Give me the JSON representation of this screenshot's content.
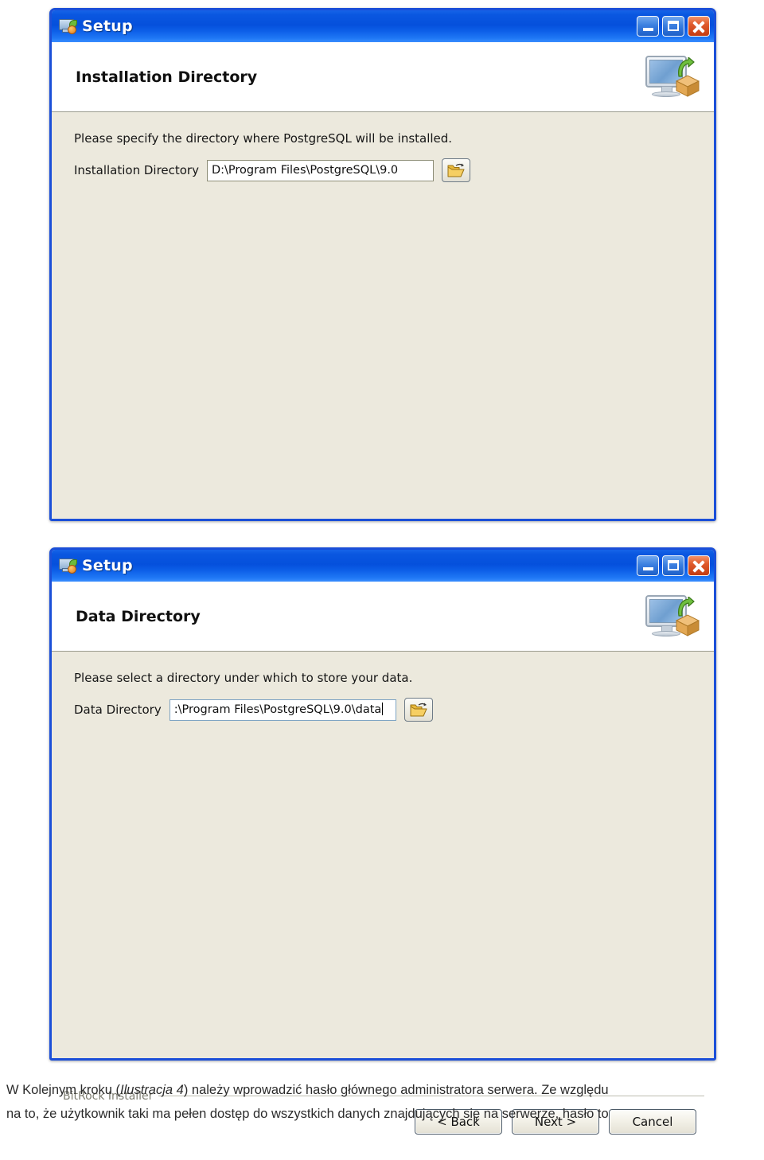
{
  "windows": [
    {
      "id": "installation-directory",
      "title": "Setup",
      "header_title": "Installation Directory",
      "instruction": "Please specify the directory where PostgreSQL will be installed.",
      "field_label": "Installation Directory",
      "field_value": "D:\\Program Files\\PostgreSQL\\9.0",
      "field_focused": false,
      "browse_icon": "open-folder-icon",
      "brand": "BitRock Installer",
      "buttons": {
        "back": "< Back",
        "next": "Next >",
        "cancel": "Cancel"
      },
      "window_controls": {
        "minimize": "minimize-icon",
        "maximize": "maximize-icon",
        "close": "close-icon"
      }
    },
    {
      "id": "data-directory",
      "title": "Setup",
      "header_title": "Data Directory",
      "instruction": "Please select a directory under which to store your data.",
      "field_label": "Data Directory",
      "field_value": ":\\Program Files\\PostgreSQL\\9.0\\data",
      "field_focused": true,
      "browse_icon": "open-folder-icon",
      "brand": "BitRock Installer",
      "buttons": {
        "back": "< Back",
        "next": "Next >",
        "cancel": "Cancel"
      },
      "window_controls": {
        "minimize": "minimize-icon",
        "maximize": "maximize-icon",
        "close": "close-icon"
      }
    }
  ],
  "caption": {
    "line1_pre": "W Kolejnym kroku (",
    "line1_italic": "Ilustracja 4",
    "line1_post": ") należy wprowadzić hasło głównego administratora serwera. Ze względu",
    "line2": "na to, że użytkownik taki ma pełen dostęp do wszystkich danych znajdujących się na serwerze, hasło to"
  },
  "colors": {
    "titlebar_blue": "#0a57e0",
    "window_border": "#1b4fd8",
    "dialog_bg": "#ece9dd",
    "header_bg": "#ffffff",
    "close_red": "#e05a2b"
  }
}
